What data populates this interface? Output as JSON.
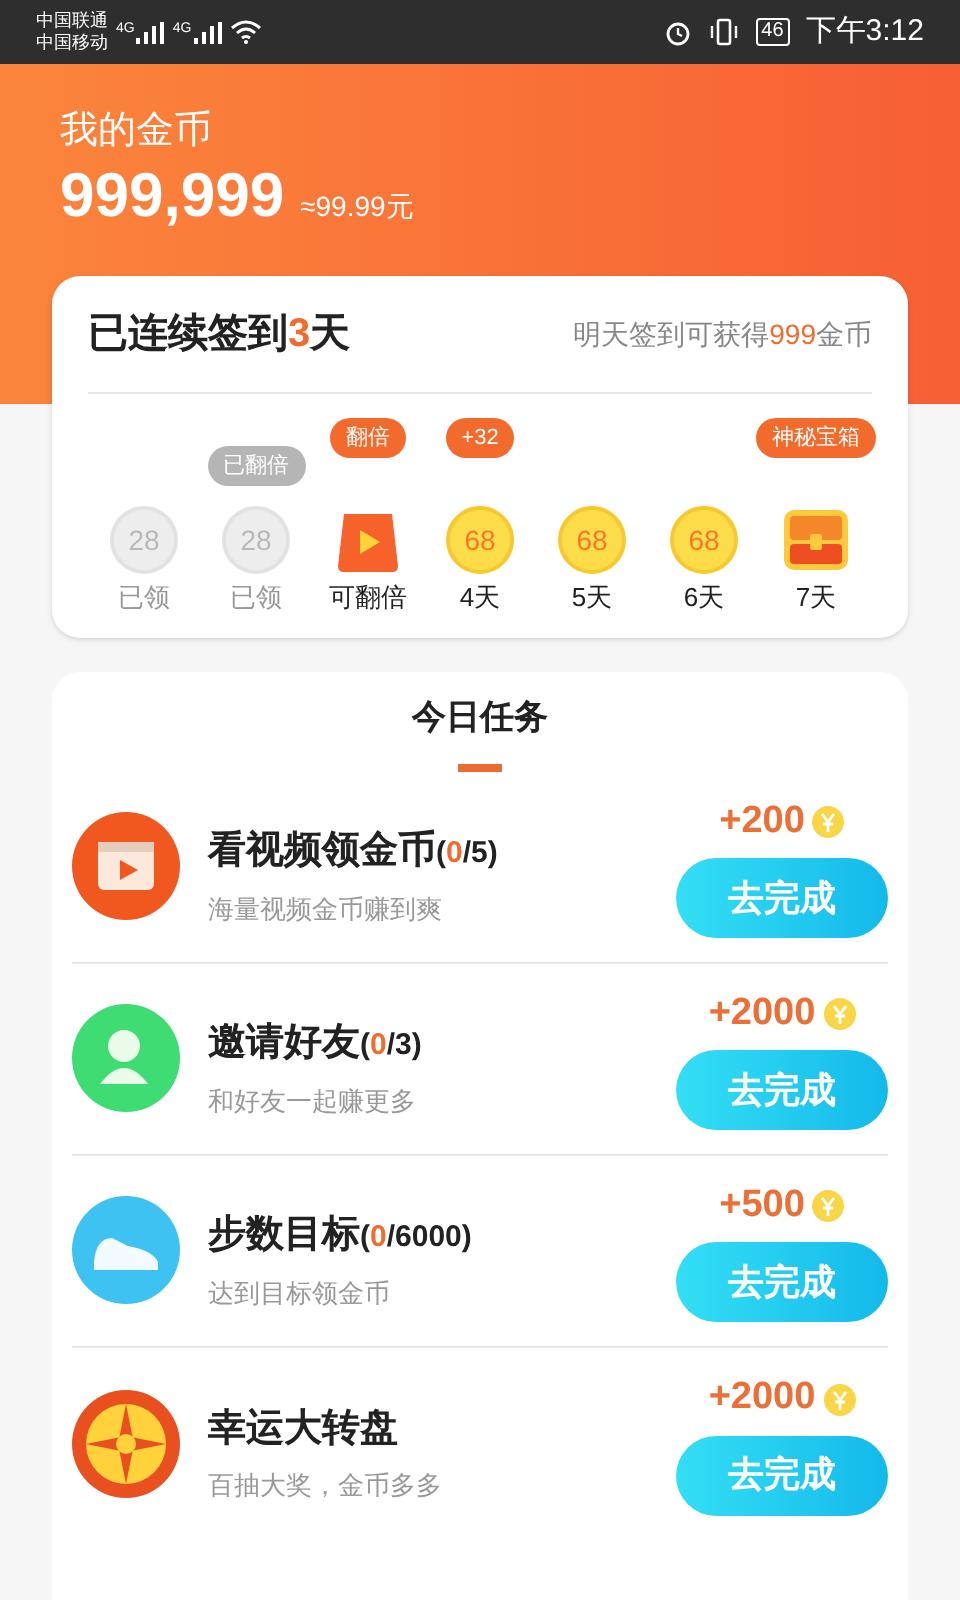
{
  "status_bar": {
    "carriers": [
      "中国联通",
      "中国移动"
    ],
    "network_labels": [
      "4G",
      "4G"
    ],
    "battery": "46",
    "time": "下午3:12"
  },
  "header": {
    "title": "我的金币",
    "balance": "999,999",
    "approx": "≈99.99元"
  },
  "checkin": {
    "title_pre": "已连续签到",
    "streak": "3",
    "title_post": "天",
    "tomorrow_pre": "明天签到可获得",
    "tomorrow_amount": "999",
    "tomorrow_post": "金币",
    "days": [
      {
        "kind": "coin",
        "value": "28",
        "label": "已领",
        "claimed": true
      },
      {
        "kind": "coin",
        "value": "28",
        "label": "已领",
        "claimed": true,
        "badge": {
          "text": "已翻倍",
          "muted": true
        }
      },
      {
        "kind": "video",
        "label": "可翻倍",
        "claimed": false,
        "badge": {
          "text": "翻倍",
          "muted": false
        }
      },
      {
        "kind": "coin",
        "value": "68",
        "label": "4天",
        "claimed": false,
        "badge": {
          "text": "+32",
          "muted": false
        }
      },
      {
        "kind": "coin",
        "value": "68",
        "label": "5天",
        "claimed": false
      },
      {
        "kind": "coin",
        "value": "68",
        "label": "6天",
        "claimed": false
      },
      {
        "kind": "chest",
        "label": "7天",
        "claimed": false,
        "badge": {
          "text": "神秘宝箱",
          "muted": false
        }
      }
    ]
  },
  "tasks": {
    "title": "今日任务",
    "items": [
      {
        "kind": "video",
        "title": "看视频领金币",
        "progress": [
          "(",
          "0",
          "/5)"
        ],
        "subtitle": "海量视频金币赚到爽",
        "reward": "+200",
        "button": "去完成"
      },
      {
        "kind": "friends",
        "title": "邀请好友",
        "progress": [
          "(",
          "0",
          "/3)"
        ],
        "subtitle": "和好友一起赚更多",
        "reward": "+2000",
        "button": "去完成"
      },
      {
        "kind": "steps",
        "title": "步数目标",
        "progress": [
          "(",
          "0",
          "/6000)"
        ],
        "subtitle": "达到目标领金币",
        "reward": "+500",
        "button": "去完成"
      },
      {
        "kind": "wheel",
        "title": "幸运大转盘",
        "subtitle": "百抽大奖，金币多多",
        "reward": "+2000",
        "button": "去完成"
      }
    ]
  }
}
